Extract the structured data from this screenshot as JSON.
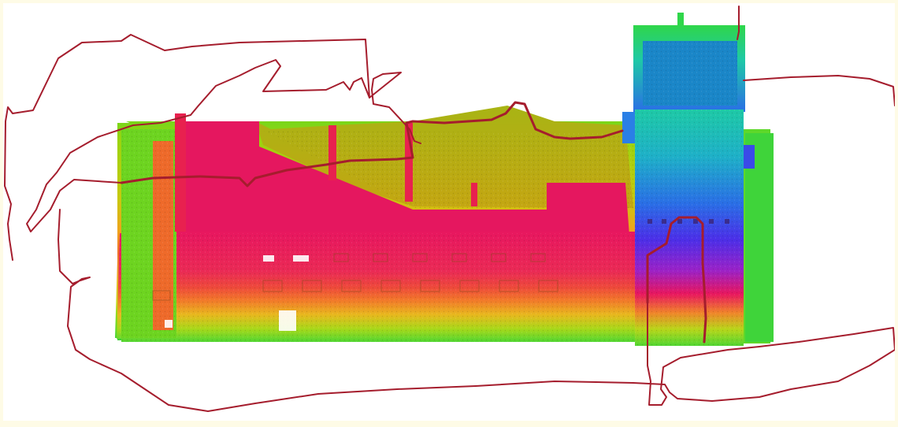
{
  "view": {
    "background": "#ffffff",
    "frame_color": "#fefbe6"
  },
  "point_cloud": {
    "colormap": [
      "#e8175f",
      "#f2592b",
      "#f6a020",
      "#c8d40e",
      "#79e01a",
      "#2fd64a",
      "#1ec9a6",
      "#2a7fe6",
      "#4b2fe8",
      "#7b22e0"
    ],
    "colormap_name": "hsv-height"
  },
  "trajectory": {
    "color": "#a51d2d"
  }
}
